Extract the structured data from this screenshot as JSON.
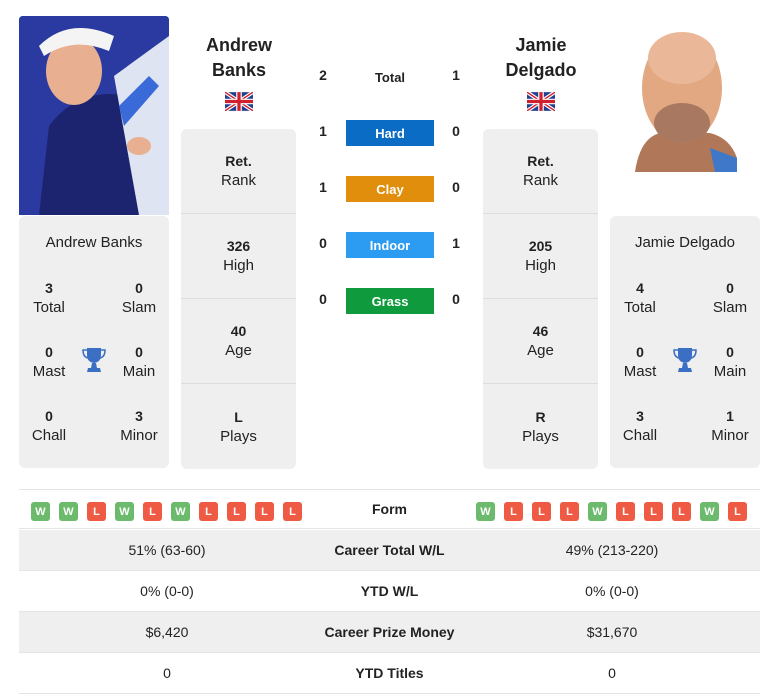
{
  "player1": {
    "name_line1": "Andrew",
    "name_line2": "Banks",
    "full_name": "Andrew Banks",
    "country_flag": "uk-flag-icon",
    "rank": {
      "value": "Ret.",
      "label": "Rank"
    },
    "high": {
      "value": "326",
      "label": "High"
    },
    "age": {
      "value": "40",
      "label": "Age"
    },
    "plays": {
      "value": "L",
      "label": "Plays"
    },
    "titles": {
      "total": {
        "value": "3",
        "label": "Total"
      },
      "slam": {
        "value": "0",
        "label": "Slam"
      },
      "mast": {
        "value": "0",
        "label": "Mast"
      },
      "main": {
        "value": "0",
        "label": "Main"
      },
      "chall": {
        "value": "0",
        "label": "Chall"
      },
      "minor": {
        "value": "3",
        "label": "Minor"
      }
    },
    "form": [
      "W",
      "W",
      "L",
      "W",
      "L",
      "W",
      "L",
      "L",
      "L",
      "L"
    ]
  },
  "player2": {
    "name_line1": "Jamie",
    "name_line2": "Delgado",
    "full_name": "Jamie Delgado",
    "country_flag": "uk-flag-icon",
    "rank": {
      "value": "Ret.",
      "label": "Rank"
    },
    "high": {
      "value": "205",
      "label": "High"
    },
    "age": {
      "value": "46",
      "label": "Age"
    },
    "plays": {
      "value": "R",
      "label": "Plays"
    },
    "titles": {
      "total": {
        "value": "4",
        "label": "Total"
      },
      "slam": {
        "value": "0",
        "label": "Slam"
      },
      "mast": {
        "value": "0",
        "label": "Mast"
      },
      "main": {
        "value": "0",
        "label": "Main"
      },
      "chall": {
        "value": "3",
        "label": "Chall"
      },
      "minor": {
        "value": "1",
        "label": "Minor"
      }
    },
    "form": [
      "W",
      "L",
      "L",
      "L",
      "W",
      "L",
      "L",
      "L",
      "W",
      "L"
    ]
  },
  "h2h": {
    "total": {
      "label": "Total",
      "p1": "2",
      "p2": "1"
    },
    "surfaces": [
      {
        "label": "Hard",
        "p1": "1",
        "p2": "0",
        "color": "#0a6cc4"
      },
      {
        "label": "Clay",
        "p1": "1",
        "p2": "0",
        "color": "#e08e0b"
      },
      {
        "label": "Indoor",
        "p1": "0",
        "p2": "1",
        "color": "#2b9cf2"
      },
      {
        "label": "Grass",
        "p1": "0",
        "p2": "0",
        "color": "#0f9a3e"
      }
    ]
  },
  "form_label": "Form",
  "stats": [
    {
      "label": "Career Total W/L",
      "p1": "51% (63-60)",
      "p2": "49% (213-220)"
    },
    {
      "label": "YTD W/L",
      "p1": "0% (0-0)",
      "p2": "0% (0-0)"
    },
    {
      "label": "Career Prize Money",
      "p1": "$6,420",
      "p2": "$31,670"
    },
    {
      "label": "YTD Titles",
      "p1": "0",
      "p2": "0"
    }
  ]
}
